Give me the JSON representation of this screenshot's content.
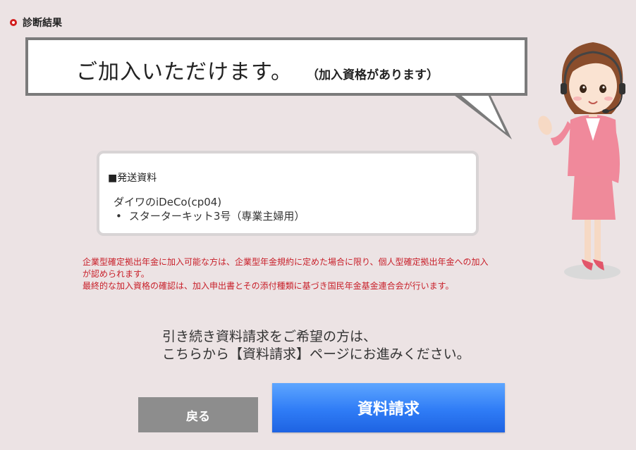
{
  "section": {
    "title": "診断結果"
  },
  "bubble": {
    "main": "ご加入いただけます。",
    "sub": "（加入資格があります）"
  },
  "materials": {
    "heading": "■発送資料",
    "product": "ダイワのiDeCo(cp04)",
    "items": [
      "スターターキット3号（専業主婦用）"
    ]
  },
  "notes": {
    "line1": "企業型確定拠出年金に加入可能な方は、企業型年金規約に定めた場合に限り、個人型確定拠出年金への加入が認められます。",
    "line2": "最終的な加入資格の確認は、加入申出書とその添付種類に基づき国民年金基金連合会が行います。"
  },
  "instruction": {
    "line1": "引き続き資料請求をご希望の方は、",
    "line2": "こちらから【資料請求】ページにお進みください。"
  },
  "buttons": {
    "back": "戻る",
    "request": "資料請求"
  },
  "colors": {
    "background": "#ece3e4",
    "accent_red": "#c8202a",
    "request_blue": "#2f7cf6",
    "back_gray": "#8d8d8d"
  },
  "icons": {
    "section_marker": "circle-marker-icon",
    "character": "support-operator-illustration"
  }
}
